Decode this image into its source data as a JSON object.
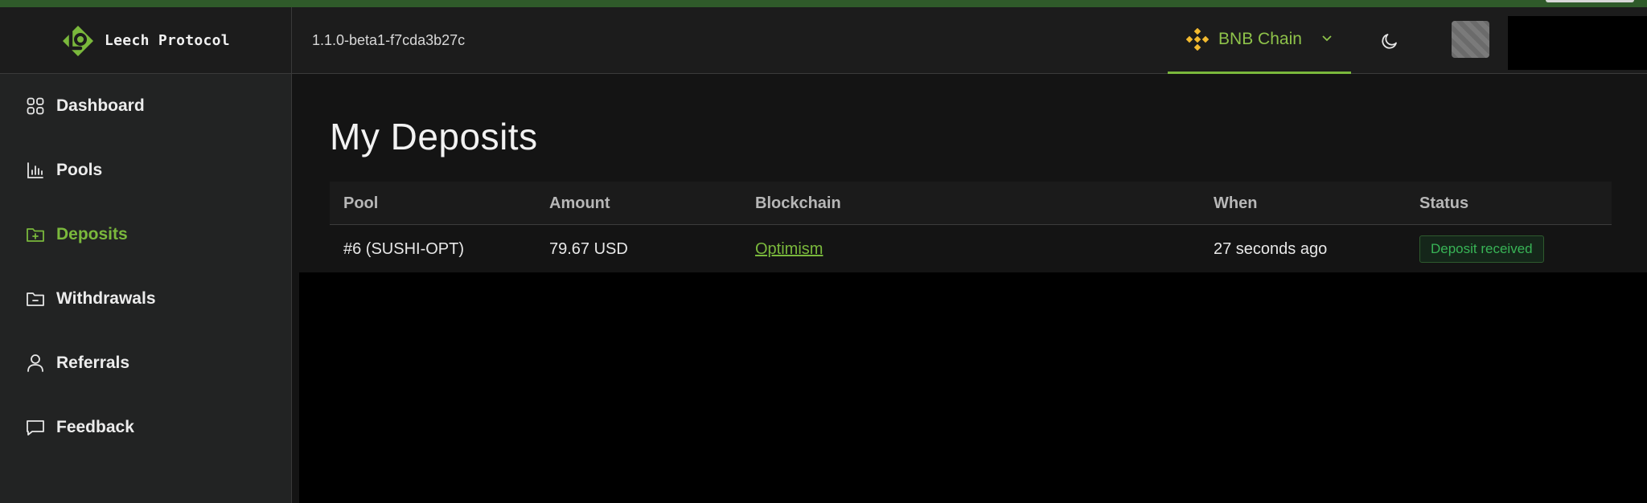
{
  "app": {
    "name": "Leech Protocol",
    "version": "1.1.0-beta1-f7cda3b27c",
    "accent_color": "#7ab83c"
  },
  "header": {
    "chain_selector": {
      "label": "BNB Chain",
      "icon": "bnb-chain-icon",
      "color": "#f3ba2f"
    },
    "theme_toggle_icon": "moon-icon"
  },
  "sidebar": {
    "items": [
      {
        "label": "Dashboard",
        "icon": "dashboard-grid-icon",
        "active": false
      },
      {
        "label": "Pools",
        "icon": "bar-chart-icon",
        "active": false
      },
      {
        "label": "Deposits",
        "icon": "folder-plus-icon",
        "active": true
      },
      {
        "label": "Withdrawals",
        "icon": "folder-minus-icon",
        "active": false
      },
      {
        "label": "Referrals",
        "icon": "user-icon",
        "active": false
      },
      {
        "label": "Feedback",
        "icon": "message-square-icon",
        "active": false
      }
    ]
  },
  "main": {
    "title": "My Deposits",
    "table": {
      "columns": [
        "Pool",
        "Amount",
        "Blockchain",
        "When",
        "Status"
      ],
      "rows": [
        {
          "pool": "#6 (SUSHI-OPT)",
          "amount": "79.67 USD",
          "blockchain": "Optimism",
          "when": "27 seconds ago",
          "status": "Deposit received"
        }
      ]
    }
  }
}
